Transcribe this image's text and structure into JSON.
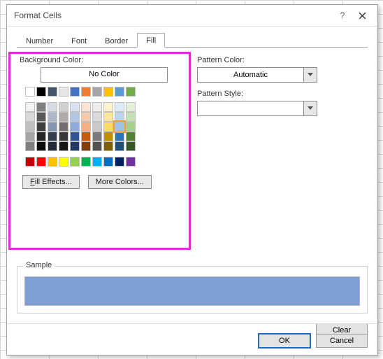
{
  "window": {
    "title": "Format Cells"
  },
  "tabs": [
    "Number",
    "Font",
    "Border",
    "Fill"
  ],
  "activeTab": 3,
  "labels": {
    "background": "Background Color:",
    "noColor": "No Color",
    "patternColor": "Pattern Color:",
    "patternStyle": "Pattern Style:",
    "sample": "Sample"
  },
  "buttons": {
    "fillEffects": "Fill Effects...",
    "moreColors": "More Colors...",
    "clear": "Clear",
    "ok": "OK",
    "cancel": "Cancel"
  },
  "patternColor": {
    "value": "Automatic"
  },
  "sampleColor": "#7d9fd3",
  "highlightColor": "#dd2fd2",
  "colors": {
    "row0": [
      "#ffffff",
      "#000000",
      "#44546a",
      "#e7e6e6",
      "#4472c4",
      "#ed7d31",
      "#a5a5a5",
      "#ffc000",
      "#5b9bd5",
      "#70ad47"
    ],
    "theme": [
      [
        "#f2f2f2",
        "#7f7f7f",
        "#d6dce4",
        "#d0cece",
        "#d9e1f2",
        "#fbe4d5",
        "#ededed",
        "#fff2cc",
        "#ddebf6",
        "#e2efd9"
      ],
      [
        "#d9d9d9",
        "#595959",
        "#acb8ca",
        "#aeaaaa",
        "#b4c6e7",
        "#f7caac",
        "#dbdbdb",
        "#ffe598",
        "#bdd6ee",
        "#c5e0b3"
      ],
      [
        "#bfbfbf",
        "#3f3f3f",
        "#8496b0",
        "#757070",
        "#8eaadb",
        "#f4b083",
        "#c9c9c9",
        "#ffd965",
        "#9cc2e5",
        "#a8d08d"
      ],
      [
        "#a5a5a5",
        "#262626",
        "#333f4f",
        "#3a3838",
        "#305496",
        "#c55a11",
        "#7b7b7b",
        "#bf8f00",
        "#2f75b5",
        "#538135"
      ],
      [
        "#7f7f7f",
        "#0c0c0c",
        "#222b35",
        "#171616",
        "#203864",
        "#833c0b",
        "#525252",
        "#7f6000",
        "#1f4e79",
        "#375623"
      ]
    ],
    "standard": [
      "#c00000",
      "#ff0000",
      "#ffc000",
      "#ffff00",
      "#92d050",
      "#00b050",
      "#00b0f0",
      "#0070c0",
      "#002060",
      "#7030a0"
    ]
  },
  "selected": {
    "group": "theme",
    "row": 2,
    "col": 8
  }
}
